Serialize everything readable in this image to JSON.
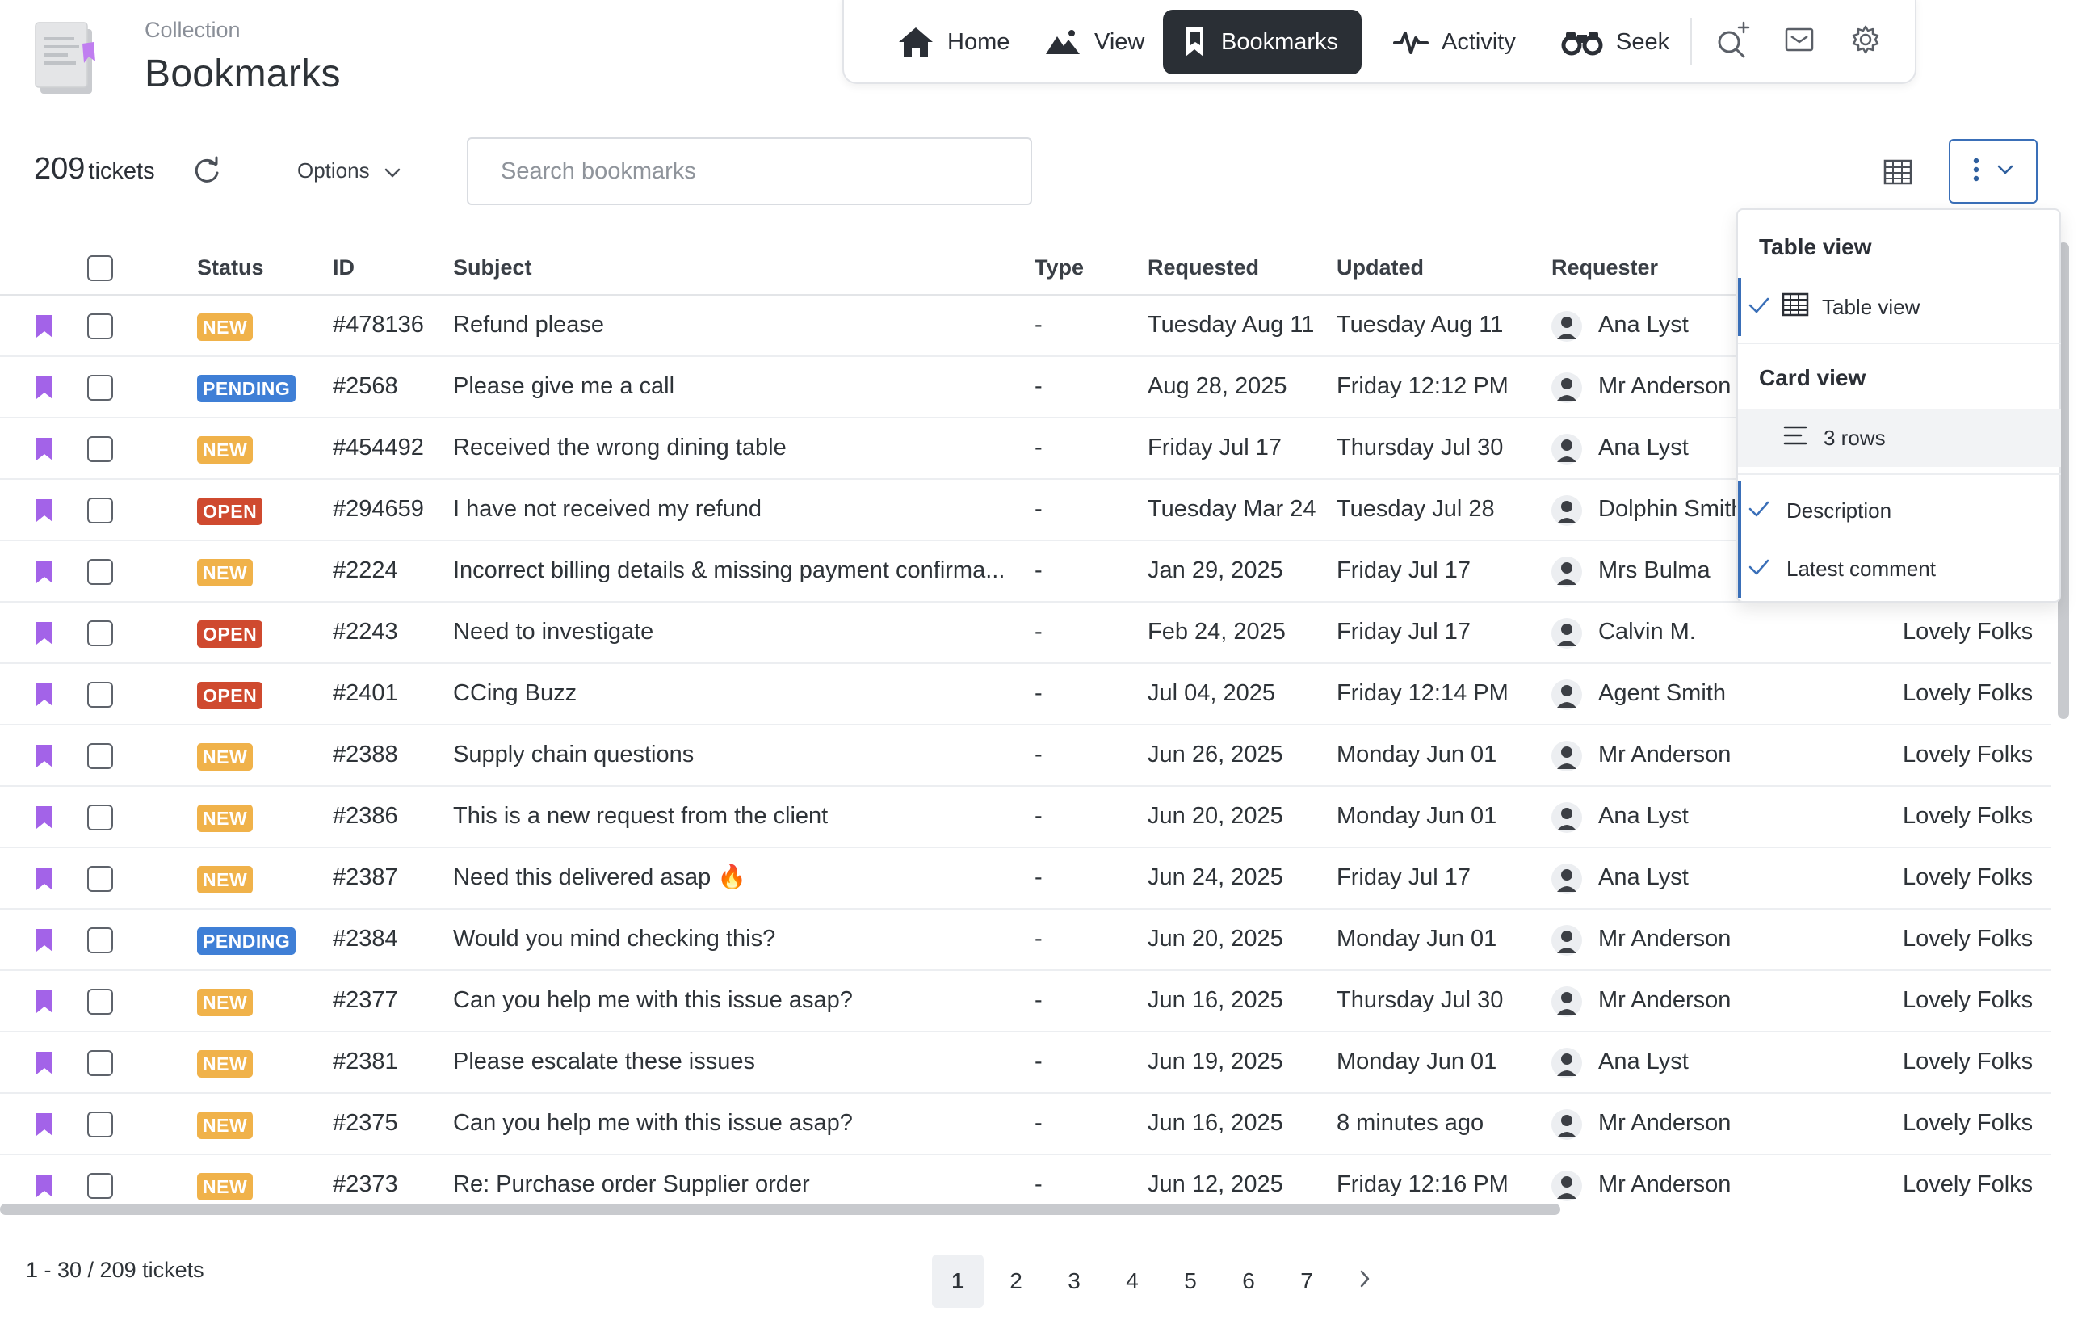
{
  "header": {
    "collection_label": "Collection",
    "title": "Bookmarks"
  },
  "nav": {
    "items": [
      {
        "label": "Home",
        "icon": "home-icon"
      },
      {
        "label": "View",
        "icon": "mountain-icon"
      },
      {
        "label": "Bookmarks",
        "icon": "bookmarks-icon",
        "active": true
      },
      {
        "label": "Activity",
        "icon": "pulse-icon"
      },
      {
        "label": "Seek",
        "icon": "binoculars-icon"
      }
    ],
    "icon_buttons": [
      "search-plus-icon",
      "inbox-icon",
      "gear-icon"
    ]
  },
  "toolbar": {
    "count": "209",
    "count_unit": "tickets",
    "options_label": "Options",
    "search_placeholder": "Search bookmarks"
  },
  "table": {
    "columns": [
      "Status",
      "ID",
      "Subject",
      "Type",
      "Requested",
      "Updated",
      "Requester"
    ],
    "rows": [
      {
        "status": "NEW",
        "id": "#478136",
        "subject": "Refund please",
        "type": "-",
        "requested": "Tuesday Aug 11",
        "updated": "Tuesday Aug 11",
        "requester": "Ana Lyst",
        "org": ""
      },
      {
        "status": "PENDING",
        "id": "#2568",
        "subject": "Please give me a call",
        "type": "-",
        "requested": "Aug 28, 2025",
        "updated": "Friday 12:12 PM",
        "requester": "Mr Anderson",
        "org": ""
      },
      {
        "status": "NEW",
        "id": "#454492",
        "subject": "Received the wrong dining table",
        "type": "-",
        "requested": "Friday Jul 17",
        "updated": "Thursday Jul 30",
        "requester": "Ana Lyst",
        "org": ""
      },
      {
        "status": "OPEN",
        "id": "#294659",
        "subject": "I have not received my refund",
        "type": "-",
        "requested": "Tuesday Mar 24",
        "updated": "Tuesday Jul 28",
        "requester": "Dolphin Smith",
        "org": ""
      },
      {
        "status": "NEW",
        "id": "#2224",
        "subject": "Incorrect billing details & missing payment confirma...",
        "type": "-",
        "requested": "Jan 29, 2025",
        "updated": "Friday Jul 17",
        "requester": "Mrs Bulma",
        "org": ""
      },
      {
        "status": "OPEN",
        "id": "#2243",
        "subject": "Need to investigate",
        "type": "-",
        "requested": "Feb 24, 2025",
        "updated": "Friday Jul 17",
        "requester": "Calvin M.",
        "org": "Lovely Folks"
      },
      {
        "status": "OPEN",
        "id": "#2401",
        "subject": "CCing Buzz",
        "type": "-",
        "requested": "Jul 04, 2025",
        "updated": "Friday 12:14 PM",
        "requester": "Agent Smith",
        "org": "Lovely Folks"
      },
      {
        "status": "NEW",
        "id": "#2388",
        "subject": "Supply chain questions",
        "type": "-",
        "requested": "Jun 26, 2025",
        "updated": "Monday Jun 01",
        "requester": "Mr Anderson",
        "org": "Lovely Folks"
      },
      {
        "status": "NEW",
        "id": "#2386",
        "subject": "This is a new request from the client",
        "type": "-",
        "requested": "Jun 20, 2025",
        "updated": "Monday Jun 01",
        "requester": "Ana Lyst",
        "org": "Lovely Folks"
      },
      {
        "status": "NEW",
        "id": "#2387",
        "subject": "Need this delivered asap 🔥",
        "type": "-",
        "requested": "Jun 24, 2025",
        "updated": "Friday Jul 17",
        "requester": "Ana Lyst",
        "org": "Lovely Folks"
      },
      {
        "status": "PENDING",
        "id": "#2384",
        "subject": "Would you mind checking this?",
        "type": "-",
        "requested": "Jun 20, 2025",
        "updated": "Monday Jun 01",
        "requester": "Mr Anderson",
        "org": "Lovely Folks"
      },
      {
        "status": "NEW",
        "id": "#2377",
        "subject": "Can you help me with this issue asap?",
        "type": "-",
        "requested": "Jun 16, 2025",
        "updated": "Thursday Jul 30",
        "requester": "Mr Anderson",
        "org": "Lovely Folks"
      },
      {
        "status": "NEW",
        "id": "#2381",
        "subject": "Please escalate these issues",
        "type": "-",
        "requested": "Jun 19, 2025",
        "updated": "Monday Jun 01",
        "requester": "Ana Lyst",
        "org": "Lovely Folks"
      },
      {
        "status": "NEW",
        "id": "#2375",
        "subject": "Can you help me with this issue asap?",
        "type": "-",
        "requested": "Jun 16, 2025",
        "updated": "8 minutes ago",
        "requester": "Mr Anderson",
        "org": "Lovely Folks"
      },
      {
        "status": "NEW",
        "id": "#2373",
        "subject": "Re: Purchase order Supplier order",
        "type": "-",
        "requested": "Jun 12, 2025",
        "updated": "Friday 12:16 PM",
        "requester": "Mr Anderson",
        "org": "Lovely Folks"
      }
    ]
  },
  "status_colors": {
    "NEW": "#f0b24a",
    "PENDING": "#3f7fd6",
    "OPEN": "#cf4a2f"
  },
  "bookmark_color": "#a363e8",
  "dropdown": {
    "table_view_header": "Table view",
    "table_view_item": "Table view",
    "card_view_header": "Card view",
    "card_rows_item": "3 rows",
    "description_item": "Description",
    "latest_comment_item": "Latest comment"
  },
  "footer": {
    "range": "1 - 30 / 209 tickets",
    "pages": [
      "1",
      "2",
      "3",
      "4",
      "5",
      "6",
      "7"
    ],
    "current_page": "1"
  }
}
